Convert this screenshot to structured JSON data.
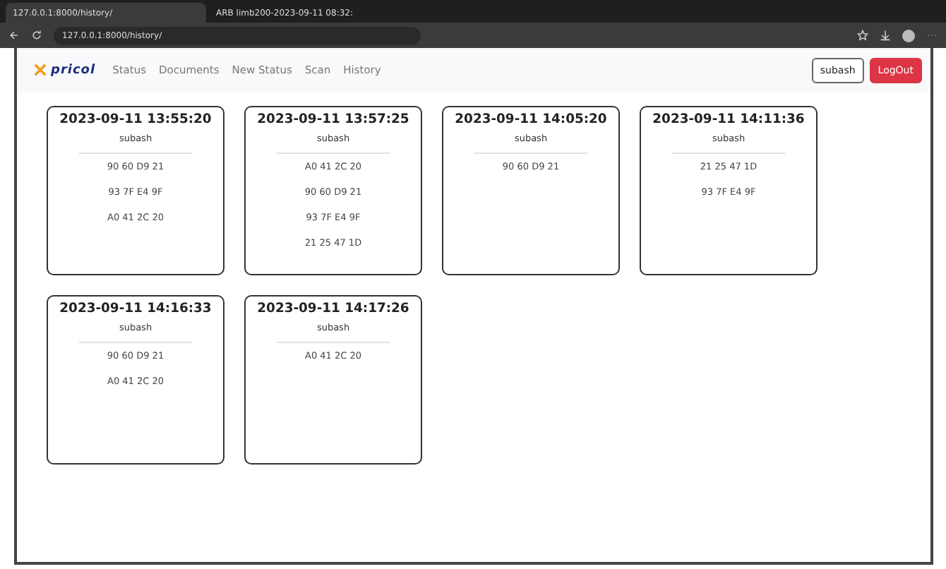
{
  "browser": {
    "tabs": [
      {
        "title": "127.0.0.1:8000/history/",
        "selected": true
      },
      {
        "title": "ARB limb200-2023-09-11 08:32:",
        "selected": false
      }
    ],
    "address": "127.0.0.1:8000/history/"
  },
  "navbar": {
    "brand": "pricol",
    "links": [
      "Status",
      "Documents",
      "New Status",
      "Scan",
      "History"
    ],
    "user": "subash",
    "logout": "LogOut"
  },
  "cards": [
    {
      "time": "2023-09-11 13:55:20",
      "user": "subash",
      "tags": [
        "90 60 D9 21",
        "93 7F E4 9F",
        "A0 41 2C 20"
      ]
    },
    {
      "time": "2023-09-11 13:57:25",
      "user": "subash",
      "tags": [
        "A0 41 2C 20",
        "90 60 D9 21",
        "93 7F E4 9F",
        "21 25 47 1D"
      ]
    },
    {
      "time": "2023-09-11 14:05:20",
      "user": "subash",
      "tags": [
        "90 60 D9 21"
      ]
    },
    {
      "time": "2023-09-11 14:11:36",
      "user": "subash",
      "tags": [
        "21 25 47 1D",
        "93 7F E4 9F"
      ]
    },
    {
      "time": "2023-09-11 14:16:33",
      "user": "subash",
      "tags": [
        "90 60 D9 21",
        "A0 41 2C 20"
      ]
    },
    {
      "time": "2023-09-11 14:17:26",
      "user": "subash",
      "tags": [
        "A0 41 2C 20"
      ]
    }
  ]
}
